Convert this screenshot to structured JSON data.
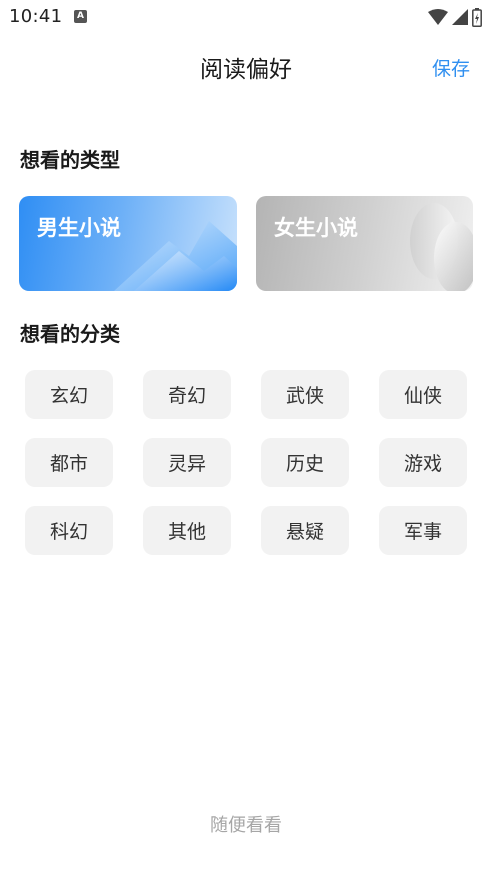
{
  "status": {
    "time": "10:41",
    "badge": "A"
  },
  "header": {
    "title": "阅读偏好",
    "save_label": "保存"
  },
  "type_section": {
    "title": "想看的类型",
    "cards": [
      {
        "label": "男生小说"
      },
      {
        "label": "女生小说"
      }
    ]
  },
  "category_section": {
    "title": "想看的分类",
    "chips": [
      "玄幻",
      "奇幻",
      "武侠",
      "仙侠",
      "都市",
      "灵异",
      "历史",
      "游戏",
      "科幻",
      "其他",
      "悬疑",
      "军事"
    ]
  },
  "footer": {
    "browse_label": "随便看看"
  },
  "colors": {
    "accent": "#2f8ff0",
    "chip_bg": "#f2f2f2",
    "muted_text": "#a6a6a6"
  },
  "icons": [
    "wifi-icon",
    "signal-icon",
    "battery-icon",
    "app-notification-icon"
  ]
}
